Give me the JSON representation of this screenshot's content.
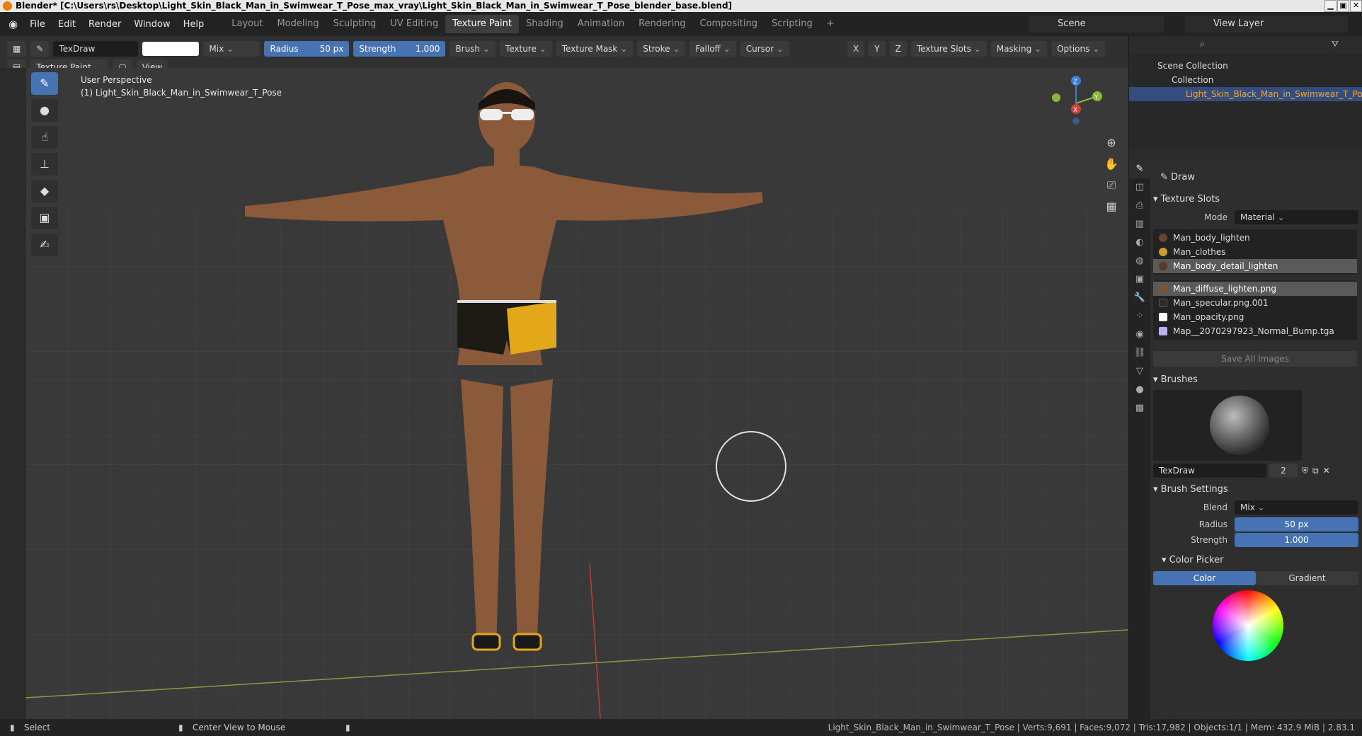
{
  "window": {
    "title": "Blender* [C:\\Users\\rs\\Desktop\\Light_Skin_Black_Man_in_Swimwear_T_Pose_max_vray\\Light_Skin_Black_Man_in_Swimwear_T_Pose_blender_base.blend]",
    "ctrl_min": "▁",
    "ctrl_max": "▣",
    "ctrl_close": "✕"
  },
  "menu": [
    "File",
    "Edit",
    "Render",
    "Window",
    "Help"
  ],
  "workspaces": [
    {
      "label": "Layout",
      "active": false
    },
    {
      "label": "Modeling",
      "active": false
    },
    {
      "label": "Sculpting",
      "active": false
    },
    {
      "label": "UV Editing",
      "active": false
    },
    {
      "label": "Texture Paint",
      "active": true
    },
    {
      "label": "Shading",
      "active": false
    },
    {
      "label": "Animation",
      "active": false
    },
    {
      "label": "Rendering",
      "active": false
    },
    {
      "label": "Compositing",
      "active": false
    },
    {
      "label": "Scripting",
      "active": false
    }
  ],
  "add_tab": "+",
  "scene": {
    "label": "Scene"
  },
  "view_layer": {
    "label": "View Layer"
  },
  "toolbar": {
    "brush_name": "TexDraw",
    "blend": "Mix",
    "radius_label": "Radius",
    "radius_value": "50 px",
    "strength_label": "Strength",
    "strength_value": "1.000",
    "menus": [
      "Brush",
      "Texture",
      "Texture Mask",
      "Stroke",
      "Falloff",
      "Cursor"
    ],
    "axes": [
      "X",
      "Y",
      "Z"
    ],
    "right_menus": [
      "Texture Slots",
      "Masking",
      "Options"
    ],
    "mode": "Texture Paint",
    "view": "View"
  },
  "viewport": {
    "perspective": "User Perspective",
    "object": "(1) Light_Skin_Black_Man_in_Swimwear_T_Pose",
    "gizmo_x": "X",
    "gizmo_y": "Y",
    "gizmo_z": "Z"
  },
  "colors": {
    "accent": "#4772b3",
    "selection_text": "#f5a623",
    "skin": "#8a5a3a",
    "swim_yellow": "#e3a81a",
    "swim_black": "#1e1a16"
  },
  "outliner": {
    "root": "Scene Collection",
    "collection": "Collection",
    "object": "Light_Skin_Black_Man_in_Swimwear_T_Pose"
  },
  "properties": {
    "tool_name": "Draw",
    "texture_slots_header": "Texture Slots",
    "mode_label": "Mode",
    "mode_value": "Material",
    "materials": [
      {
        "name": "Man_body_lighten",
        "selected": false,
        "color": "#6b4430"
      },
      {
        "name": "Man_clothes",
        "selected": false,
        "color": "#c9a030"
      },
      {
        "name": "Man_body_detail_lighten",
        "selected": true,
        "color": "#5a3a28"
      }
    ],
    "images": [
      {
        "name": "Man_diffuse_lighten.png",
        "selected": true,
        "color": "#7a5236"
      },
      {
        "name": "Man_specular.png.001",
        "selected": false,
        "color": "#2a2a2a"
      },
      {
        "name": "Man_opacity.png",
        "selected": false,
        "color": "#ffffff"
      },
      {
        "name": "Map__2070297923_Normal_Bump.tga",
        "selected": false,
        "color": "#b8b0f0"
      }
    ],
    "save_all": "Save All Images",
    "brushes_header": "Brushes",
    "brush_name": "TexDraw",
    "brush_users": "2",
    "brush_settings_header": "Brush Settings",
    "blend_label": "Blend",
    "blend_value": "Mix",
    "radius_label": "Radius",
    "radius_value": "50 px",
    "strength_label": "Strength",
    "strength_value": "1.000",
    "color_picker_header": "Color Picker",
    "color_tab": "Color",
    "gradient_tab": "Gradient"
  },
  "status": {
    "select": "Select",
    "center": "Center View to Mouse",
    "stats": "Light_Skin_Black_Man_in_Swimwear_T_Pose | Verts:9,691 | Faces:9,072 | Tris:17,982 | Objects:1/1 | Mem: 432.9 MiB | 2.83.1"
  }
}
